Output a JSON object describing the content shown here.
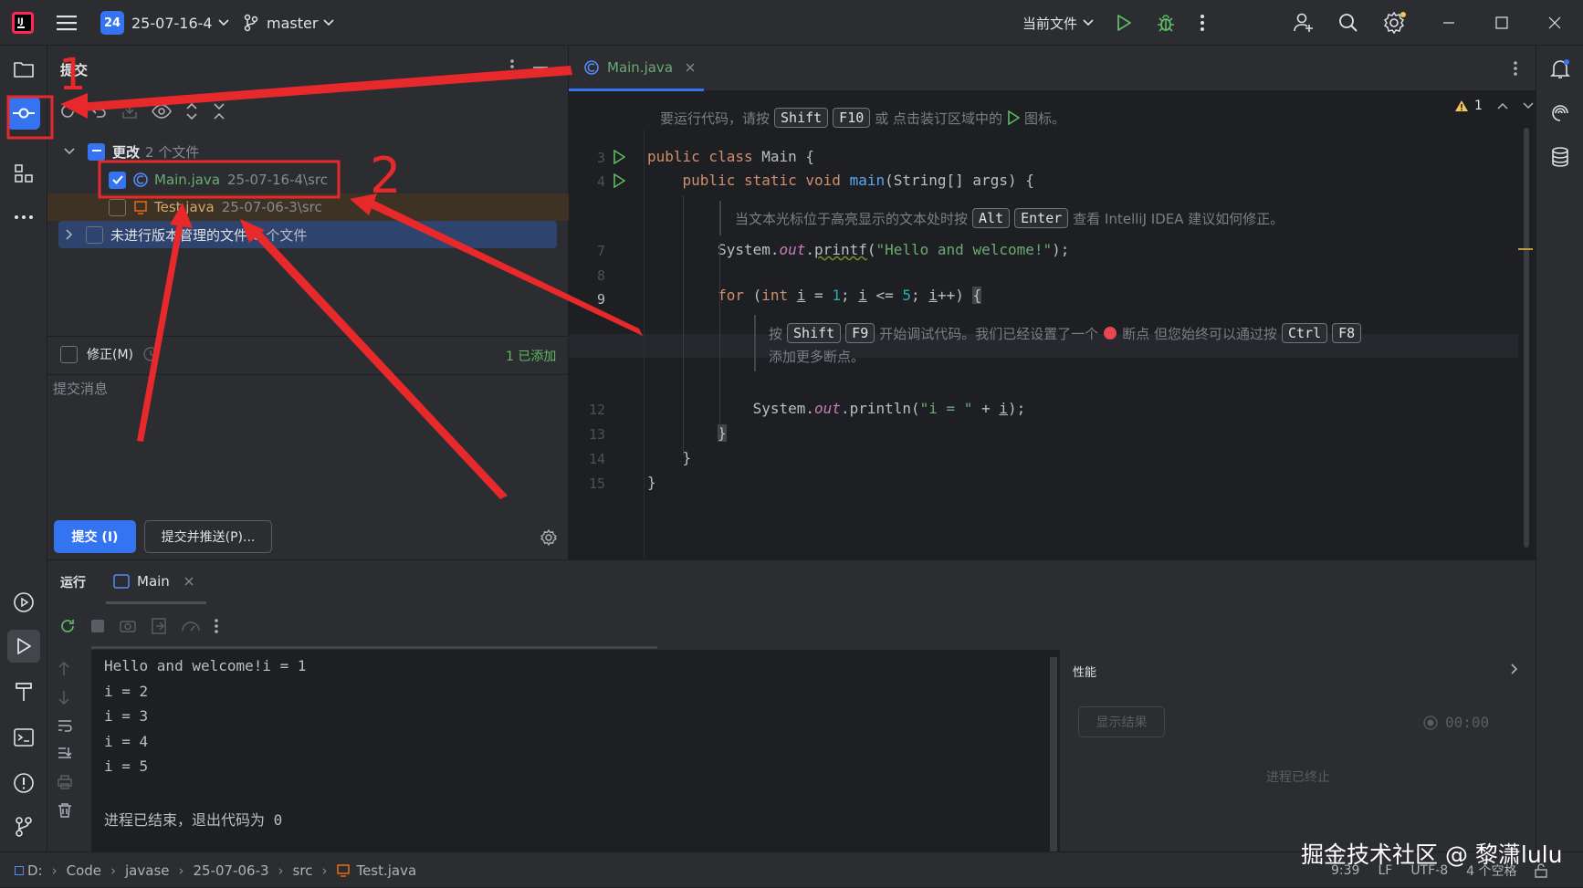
{
  "titlebar": {
    "project_badge": "24",
    "project_name": "25-07-16-4",
    "branch": "master",
    "run_config": "当前文件"
  },
  "commit_panel": {
    "title": "提交",
    "changes_group": "更改",
    "changes_count": "2 个文件",
    "files": [
      {
        "name": "Main.java",
        "path": "25-07-16-4\\src",
        "checked": true
      },
      {
        "name": "Test.java",
        "path": "25-07-06-3\\src",
        "checked": false
      }
    ],
    "unversioned_label": "未进行版本管理的文件",
    "unversioned_count": "8 个文件",
    "amend_label": "修正(M)",
    "added_status": "1 已添加",
    "message_placeholder": "提交消息",
    "commit_button": "提交 (I)",
    "commit_push_button": "提交并推送(P)..."
  },
  "editor": {
    "tab_label": "Main.java",
    "warning_count": "1",
    "run_hint": {
      "prefix": "要运行代码，请按",
      "key1": "Shift",
      "key2": "F10",
      "suffix": "或 点击装订区域中的",
      "end": "图标。"
    },
    "fix_hint": {
      "prefix": "当文本光标位于高亮显示的文本处时按",
      "key1": "Alt",
      "key2": "Enter",
      "suffix": "查看 IntelliJ IDEA 建议如何修正。"
    },
    "debug_hint": {
      "prefix": "按",
      "key1": "Shift",
      "key2": "F9",
      "middle": "开始调试代码。我们已经设置了一个",
      "middle2": "断点 但您始终可以通过按",
      "key3": "Ctrl",
      "key4": "F8",
      "line2": "添加更多断点。"
    },
    "line_numbers": [
      "3",
      "4",
      "7",
      "8",
      "9",
      "12",
      "13",
      "14",
      "15"
    ]
  },
  "run_panel": {
    "tab_run": "运行",
    "tab_main": "Main",
    "output": [
      "Hello and welcome!i = 1",
      "i = 2",
      "i = 3",
      "i = 4",
      "i = 5",
      "",
      "进程已结束，退出代码为 0"
    ],
    "perf_title": "性能",
    "show_results": "显示结果",
    "timer": "00:00",
    "process_ended": "进程已终止"
  },
  "statusbar": {
    "breadcrumbs": [
      "D:",
      "Code",
      "javase",
      "25-07-06-3",
      "src",
      "Test.java"
    ],
    "position": "9:39",
    "line_sep": "LF",
    "encoding": "UTF-8",
    "indent": "4 个空格"
  },
  "annotations": {
    "num1": "1",
    "num2": "2"
  },
  "watermark": "掘金技术社区 @ 黎潇lulu",
  "colors": {
    "accent": "#3574f0",
    "annotation": "#e8292c",
    "string": "#6aab73",
    "keyword": "#cf8e6d",
    "number": "#2aacb8"
  }
}
